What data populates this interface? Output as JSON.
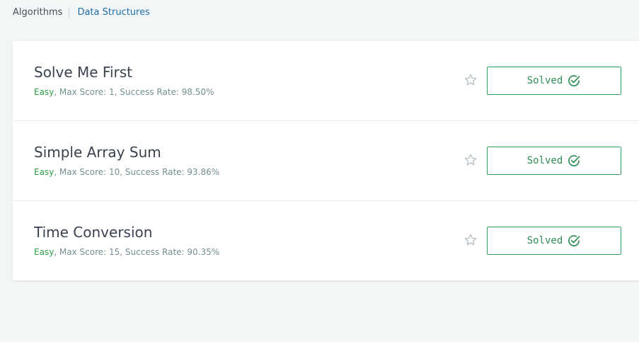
{
  "breadcrumb": {
    "root": "Algorithms",
    "current": "Data Structures"
  },
  "challenges": [
    {
      "title": "Solve Me First",
      "difficulty": "Easy",
      "details": ", Max Score: 1, Success Rate: 98.50%",
      "status_label": "Solved"
    },
    {
      "title": "Simple Array Sum",
      "difficulty": "Easy",
      "details": ", Max Score: 10, Success Rate: 93.86%",
      "status_label": "Solved"
    },
    {
      "title": "Time Conversion",
      "difficulty": "Easy",
      "details": ", Max Score: 15, Success Rate: 90.35%",
      "status_label": "Solved"
    }
  ],
  "icons": {
    "star": "star-outline-icon",
    "solved": "check-circle-icon"
  },
  "colors": {
    "background": "#f3f6f7",
    "accent_green": "#2ea043",
    "link_blue": "#1d6ea8",
    "title_text": "#39424e"
  }
}
